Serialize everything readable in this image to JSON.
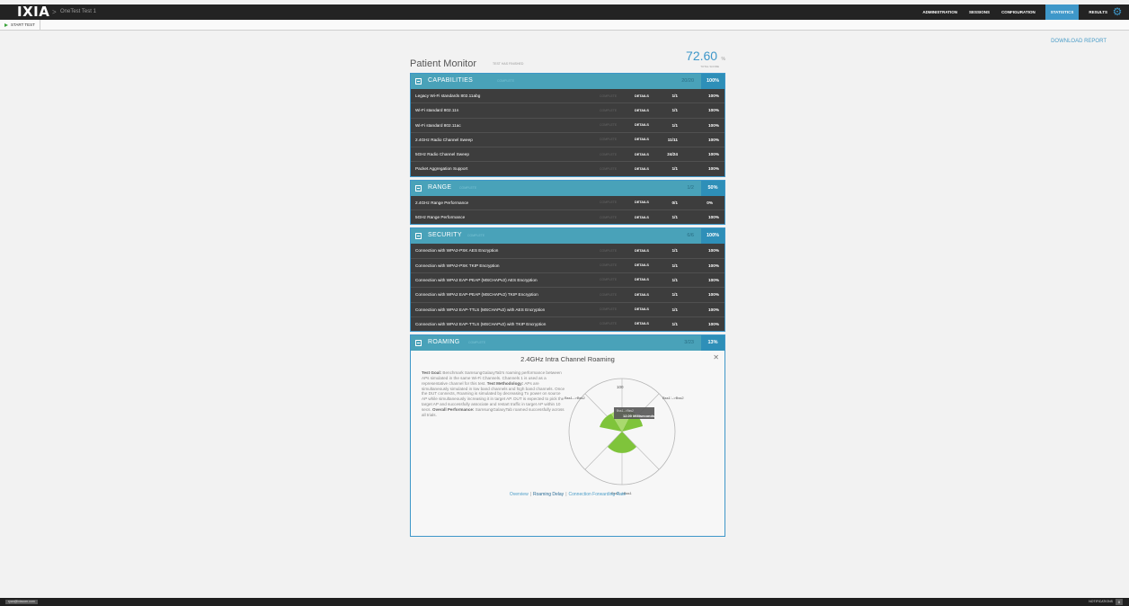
{
  "topbar": {
    "logo": "IXIA",
    "crumb_sep": ">",
    "breadcrumb": "OneTest Test 1",
    "nav": [
      "ADMINISTRATION",
      "SESSIONS",
      "CONFIGURATION",
      "STATISTICS",
      "RESULTS"
    ],
    "active_nav": "STATISTICS",
    "settings_icon": "gear-icon"
  },
  "toolbar": {
    "start_test": "START TEST"
  },
  "download_report": "DOWNLOAD REPORT",
  "header": {
    "title": "Patient Monitor",
    "status": "TEST HAS FINISHED",
    "score": "72.60",
    "score_unit": "%",
    "score_label": "TOTAL SCORE"
  },
  "capabilities": {
    "name": "CAPABILITIES",
    "state": "COMPLETE",
    "count": "20/20",
    "pct": "100%",
    "rows": [
      {
        "name": "Legacy Wi-Fi standards 802.11abg",
        "state": "COMPLETE",
        "details": "DETAILS",
        "count": "1/1",
        "pct": "100%"
      },
      {
        "name": "Wi-Fi standard 802.11n",
        "state": "COMPLETE",
        "details": "DETAILS",
        "count": "1/1",
        "pct": "100%"
      },
      {
        "name": "Wi-Fi standard 802.11ac",
        "state": "COMPLETE",
        "details": "DETAILS",
        "count": "1/1",
        "pct": "100%"
      },
      {
        "name": "2.4GHz Radio Channel Sweep",
        "state": "COMPLETE",
        "details": "DETAILS",
        "count": "11/11",
        "pct": "100%"
      },
      {
        "name": "5GHz Radio Channel Sweep",
        "state": "COMPLETE",
        "details": "DETAILS",
        "count": "24/24",
        "pct": "100%"
      },
      {
        "name": "Packet Aggregation Support",
        "state": "COMPLETE",
        "details": "DETAILS",
        "count": "1/1",
        "pct": "100%"
      }
    ]
  },
  "range": {
    "name": "RANGE",
    "state": "COMPLETE",
    "count": "1/2",
    "pct": "50%",
    "rows": [
      {
        "name": "2.4GHz Range Performance",
        "state": "COMPLETE",
        "details": "DETAILS",
        "count": "0/1",
        "pct": "0%"
      },
      {
        "name": "5GHz Range Performance",
        "state": "COMPLETE",
        "details": "DETAILS",
        "count": "1/1",
        "pct": "100%"
      }
    ]
  },
  "security": {
    "name": "SECURITY",
    "state": "COMPLETE",
    "count": "6/6",
    "pct": "100%",
    "rows": [
      {
        "name": "Connection with WPA2-PSK AES Encryption",
        "state": "COMPLETE",
        "details": "DETAILS",
        "count": "1/1",
        "pct": "100%"
      },
      {
        "name": "Connection with WPA2-PSK TKIP Encryption",
        "state": "COMPLETE",
        "details": "DETAILS",
        "count": "1/1",
        "pct": "100%"
      },
      {
        "name": "Connection with WPA2 EAP-PEAP (MSCHAPv2) AES Encryption",
        "state": "COMPLETE",
        "details": "DETAILS",
        "count": "1/1",
        "pct": "100%"
      },
      {
        "name": "Connection with WPA2 EAP-PEAP (MSCHAPv2) TKIP Encryption",
        "state": "COMPLETE",
        "details": "DETAILS",
        "count": "1/1",
        "pct": "100%"
      },
      {
        "name": "Connection with WPA2 EAP-TTLS (MSCHAPv2) with AES Encryption",
        "state": "COMPLETE",
        "details": "DETAILS",
        "count": "1/1",
        "pct": "100%"
      },
      {
        "name": "Connection with WPA2 EAP-TTLS (MSCHAPv2) with TKIP Encryption",
        "state": "COMPLETE",
        "details": "DETAILS",
        "count": "1/1",
        "pct": "100%"
      }
    ]
  },
  "roaming": {
    "name": "ROAMING",
    "state": "COMPLETE",
    "count": "3/23",
    "pct": "13%",
    "panel_title": "2.4GHz Intra Channel Roaming",
    "close_icon": "close-icon",
    "goal_label": "Test Goal:",
    "goal_text": "Benchmark SamsungGalaxyTab's roaming performance between APs simulated in the same Wi-Fi Channels. Channels 1 is used as a representative channel for this test.",
    "method_label": "Test Methodology:",
    "method_text": "APs are simultaneously simulated in low band channels and high band channels. Once the DUT connects, Roaming is simulated by decreasing Tx power on source AP while simultaneously increasing it in target AP. DUT is expected to pick the target AP and successfully associate and restart traffic in target AP within 10 secs.",
    "perf_label": "Overall Performance:",
    "perf_text": "SamsungGalaxyTab roamed successfully across all trials.",
    "links": [
      "Overview",
      "Roaming Delay",
      "Connection Forwarding Rate"
    ],
    "active_link": "Roaming Delay"
  },
  "chart_data": {
    "type": "radar",
    "axes": [
      "Bss1-->Bss2",
      "Bss1'-->Bss2",
      "Bss2-->Bss1"
    ],
    "axis_max_label": "100",
    "tooltip_title": "Bss1-->Bss2",
    "tooltip_value": "12.00 Milliseconds",
    "color": "#7fc43b"
  },
  "statusbar": {
    "user": "ryan@ixiacom.com",
    "notifications": "NOTIFICATIONS",
    "notif_count": "0"
  }
}
